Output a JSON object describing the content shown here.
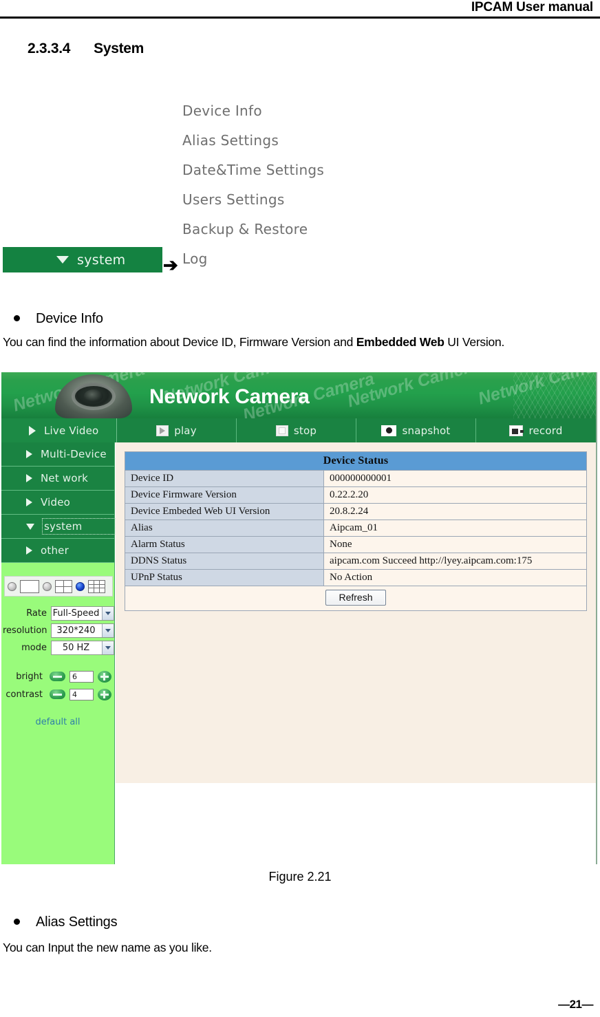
{
  "document": {
    "header_title": "IPCAM User manual",
    "section_number": "2.3.3.4",
    "section_title": "System",
    "figure_caption": "Figure 2.21",
    "page_number": "—21—"
  },
  "menu_illustration": {
    "items": [
      "Device Info",
      "Alias Settings",
      "Date&Time Settings",
      "Users Settings",
      "Backup & Restore",
      "Log"
    ],
    "button_label": "system",
    "arrow": "➔"
  },
  "bullets": [
    {
      "title": "Device Info",
      "body_prefix": "You can find the information about Device ID, Firmware Version and ",
      "body_bold": "Embedded Web",
      "body_suffix": " UI Version."
    },
    {
      "title": "Alias Settings",
      "body": "You can Input the new name as you like."
    }
  ],
  "app": {
    "banner": {
      "title": "Network Camera",
      "watermark": "Network Camera"
    },
    "toolbar": {
      "live_video": "Live Video",
      "buttons": [
        {
          "label": "play",
          "icon": "play-icon"
        },
        {
          "label": "stop",
          "icon": "stop-icon"
        },
        {
          "label": "snapshot",
          "icon": "camera-icon"
        },
        {
          "label": "record",
          "icon": "camcorder-icon"
        }
      ]
    },
    "sidebar": {
      "items": [
        {
          "label": "Multi-Device",
          "state": "collapsed"
        },
        {
          "label": "Net work",
          "state": "collapsed"
        },
        {
          "label": "Video",
          "state": "collapsed"
        },
        {
          "label": "system",
          "state": "expanded"
        },
        {
          "label": "other",
          "state": "collapsed"
        }
      ]
    },
    "view_selector": {
      "options": [
        {
          "layout": "single-pane",
          "selected": false
        },
        {
          "layout": "four-pane",
          "selected": false
        },
        {
          "layout": "nine-pane",
          "selected": true
        }
      ]
    },
    "controls": {
      "rate_label": "Rate",
      "rate_value": "Full-Speed",
      "resolution_label": "resolution",
      "resolution_value": "320*240",
      "mode_label": "mode",
      "mode_value": "50 HZ",
      "bright_label": "bright",
      "bright_value": "6",
      "contrast_label": "contrast",
      "contrast_value": "4",
      "default_all": "default all"
    },
    "device_status": {
      "title": "Device Status",
      "rows": [
        {
          "label": "Device ID",
          "value": "000000000001"
        },
        {
          "label": "Device Firmware Version",
          "value": "0.22.2.20"
        },
        {
          "label": "Device Embeded Web UI Version",
          "value": "20.8.2.24"
        },
        {
          "label": "Alias",
          "value": "Aipcam_01"
        },
        {
          "label": "Alarm Status",
          "value": "None"
        },
        {
          "label": "DDNS Status",
          "value": "aipcam.com  Succeed  http://lyey.aipcam.com:175"
        },
        {
          "label": "UPnP Status",
          "value": "No Action"
        }
      ],
      "refresh_label": "Refresh"
    },
    "colors": {
      "header_green": "#1a8342",
      "sidebar_green": "#99fb7b",
      "content_beige": "#f8efe4",
      "table_header_blue": "#5a9bd4",
      "table_label_blue": "#cfd8e4",
      "table_value_cream": "#fdf5ec"
    }
  }
}
